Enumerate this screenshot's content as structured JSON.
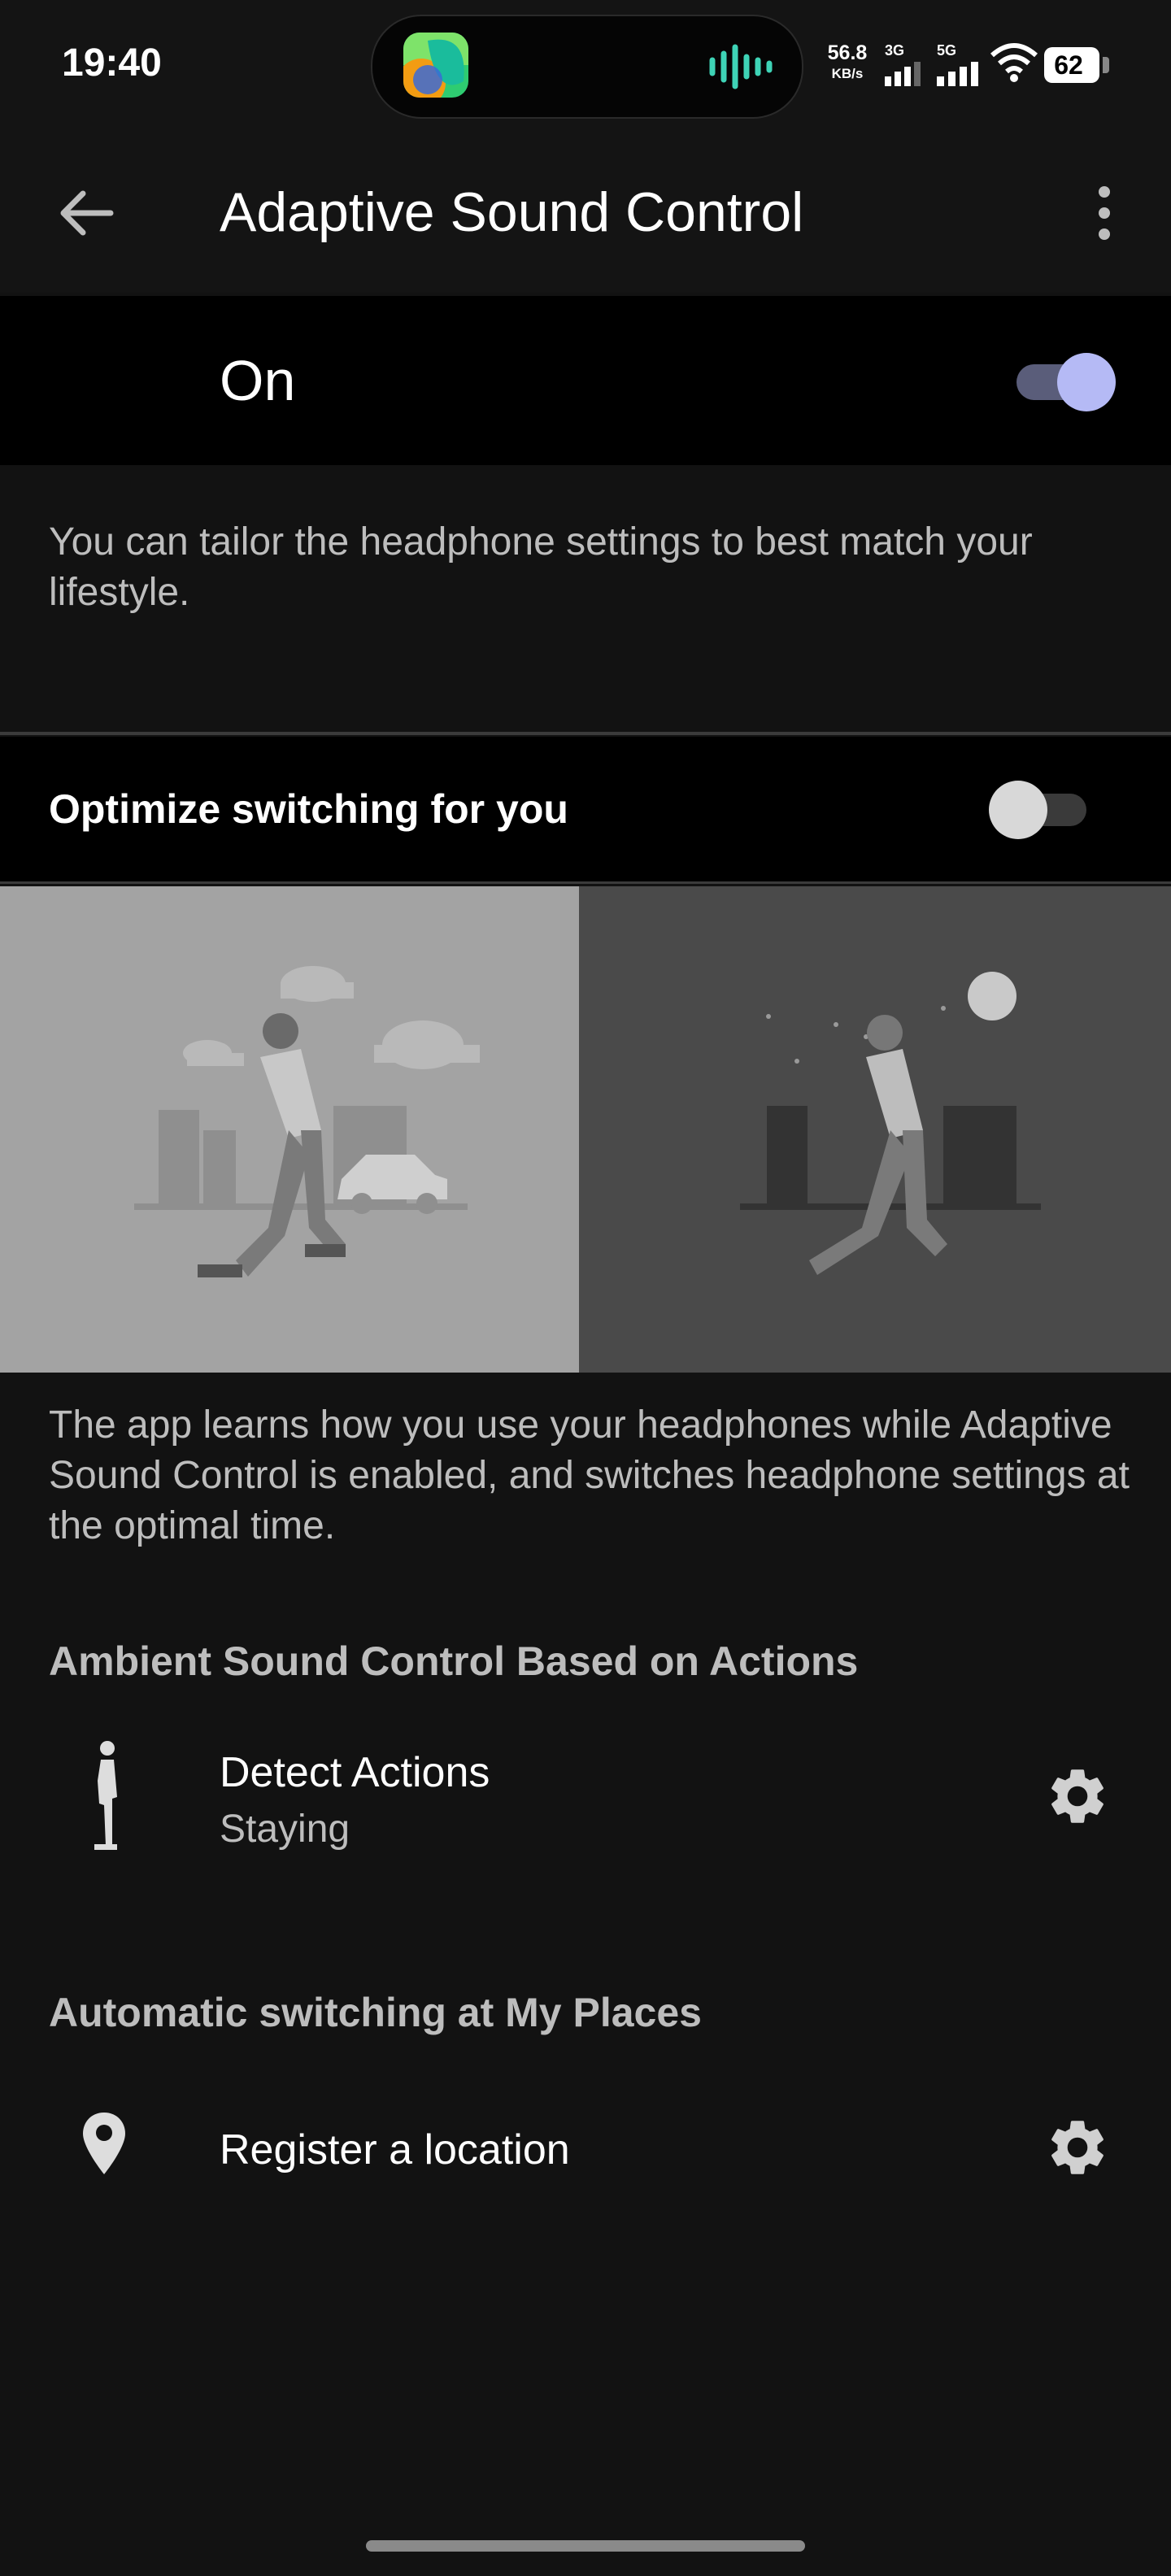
{
  "status_bar": {
    "time": "19:40",
    "net_speed_value": "56.8",
    "net_speed_unit": "KB/s",
    "sim1_label": "3G",
    "sim2_label": "5G",
    "battery": "62"
  },
  "app_bar": {
    "title": "Adaptive Sound Control",
    "back_icon": "arrow-left-icon",
    "menu_icon": "more-vert-icon"
  },
  "main_switch": {
    "label": "On",
    "state": true,
    "accent": "#b5baf5"
  },
  "intro_text": "You can tailor the headphone settings to best match your lifestyle.",
  "optimize": {
    "label": "Optimize switching for you",
    "state": false
  },
  "illustration": {
    "panels": [
      "day-walking-illustration",
      "night-walking-illustration"
    ]
  },
  "learn_text": "The app learns how you use your headphones while Adaptive Sound Control is enabled, and switches headphone settings at the optimal time.",
  "sections": {
    "actions": {
      "header": "Ambient Sound Control Based on Actions",
      "item_title": "Detect Actions",
      "item_sub": "Staying",
      "icon": "standing-person-icon"
    },
    "places": {
      "header": "Automatic switching at My Places",
      "item_title": "Register a location",
      "icon": "location-pin-icon"
    }
  }
}
